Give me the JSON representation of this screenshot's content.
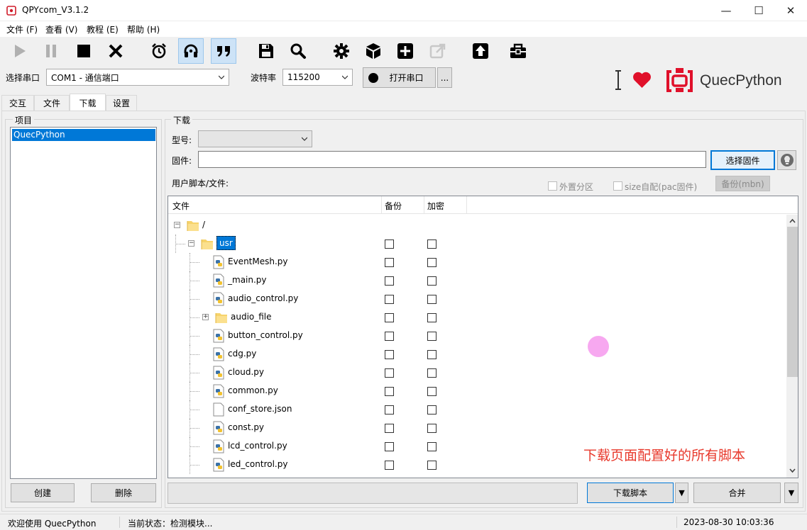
{
  "window": {
    "title": "QPYcom_V3.1.2",
    "minimize_glyph": "—",
    "maximize_glyph": "☐",
    "close_glyph": "✕"
  },
  "menu": [
    "文件 (F)",
    "查看 (V)",
    "教程 (E)",
    "帮助 (H)"
  ],
  "toolbar": {
    "icons": [
      "play-icon",
      "pause-icon",
      "stop-icon",
      "close-icon",
      "alarm-clock-icon",
      "headset-icon",
      "quote-icon",
      "save-icon",
      "search-icon",
      "gear-icon",
      "cube-icon",
      "plus-box-icon",
      "external-link-icon",
      "upload-icon",
      "toolbox-icon"
    ]
  },
  "port": {
    "label": "选择串口",
    "value": "COM1 - 通信端口",
    "baud_label": "波特率",
    "baud_value": "115200",
    "open_button": "打开串口",
    "more_button": "..."
  },
  "brand": {
    "cursor": "I",
    "logo_text": "QuecPython",
    "heart_color": "#e0102a",
    "logo_color": "#e0102a"
  },
  "tabs": [
    "交互",
    "文件",
    "下载",
    "设置"
  ],
  "project": {
    "group_title": "项目",
    "items": [
      "QuecPython"
    ],
    "create_button": "创建",
    "delete_button": "删除"
  },
  "download": {
    "group_title": "下载",
    "model_label": "型号:",
    "model_value": "",
    "firmware_label": "固件:",
    "firmware_value": "",
    "choose_firmware_button": "选择固件",
    "user_scripts_label": "用户脚本/文件:",
    "external_partition": "外置分区",
    "size_auto": "size自配(pac固件)",
    "backup_button": "备份(mbn)",
    "columns": [
      "文件",
      "备份",
      "加密"
    ],
    "tree": [
      {
        "name": "/",
        "type": "folder",
        "level": 0,
        "expander": "⊟"
      },
      {
        "name": "usr",
        "type": "folder",
        "level": 1,
        "expander": "⊟",
        "selected": true
      },
      {
        "name": "EventMesh.py",
        "type": "py",
        "level": 2
      },
      {
        "name": "_main.py",
        "type": "py",
        "level": 2
      },
      {
        "name": "audio_control.py",
        "type": "py",
        "level": 2
      },
      {
        "name": "audio_file",
        "type": "folder",
        "level": 2,
        "expander": "⊞"
      },
      {
        "name": "button_control.py",
        "type": "py",
        "level": 2
      },
      {
        "name": "cdg.py",
        "type": "py",
        "level": 2
      },
      {
        "name": "cloud.py",
        "type": "py",
        "level": 2
      },
      {
        "name": "common.py",
        "type": "py",
        "level": 2
      },
      {
        "name": "conf_store.json",
        "type": "file",
        "level": 2
      },
      {
        "name": "const.py",
        "type": "py",
        "level": 2
      },
      {
        "name": "lcd_control.py",
        "type": "py",
        "level": 2
      },
      {
        "name": "led_control.py",
        "type": "py",
        "level": 2
      }
    ],
    "annotation": "下载页面配置好的所有脚本",
    "annotation_color": "#e8382b",
    "download_script_button": "下载脚本",
    "merge_button": "合并",
    "dropdown_glyph": "▼"
  },
  "status": {
    "welcome": "欢迎使用 QuecPython",
    "state": "当前状态：检测模块...",
    "datetime": "2023-08-30 10:03:36"
  },
  "colors": {
    "selection": "#0078d7",
    "highlight_marker": "#f7a8f0"
  }
}
